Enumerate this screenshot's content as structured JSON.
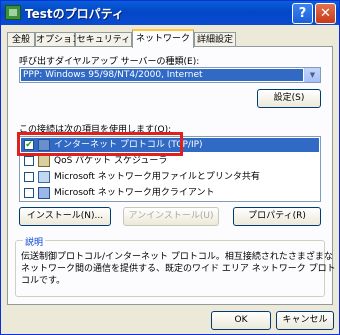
{
  "window": {
    "title": "Testのプロパティ",
    "help_label": "?",
    "close_label": "✕"
  },
  "tabs": [
    {
      "label": "全般",
      "active": false
    },
    {
      "label": "オプション",
      "active": false
    },
    {
      "label": "セキュリティ",
      "active": false
    },
    {
      "label": "ネットワーク",
      "active": true
    },
    {
      "label": "詳細設定",
      "active": false
    }
  ],
  "server_type": {
    "label": "呼び出すダイヤルアップ サーバーの種類(E):",
    "value": "PPP: Windows 95/98/NT4/2000, Internet",
    "settings_button": "設定(S)"
  },
  "components": {
    "label": "この接続は次の項目を使用します(O):",
    "items": [
      {
        "label": "インターネット プロトコル (TCP/IP)",
        "checked": true,
        "icon": "network-protocol-icon",
        "selected": true
      },
      {
        "label": "QoS パケット スケジューラ",
        "checked": false,
        "icon": "scheduler-icon",
        "selected": false
      },
      {
        "label": "Microsoft ネットワーク用ファイルとプリンタ共有",
        "checked": false,
        "icon": "file-printer-sharing-icon",
        "selected": false
      },
      {
        "label": "Microsoft ネットワーク用クライアント",
        "checked": false,
        "icon": "network-client-icon",
        "selected": false
      }
    ],
    "install_button": "インストール(N)...",
    "uninstall_button": "アンインストール(U)",
    "properties_button": "プロパティ(R)"
  },
  "description": {
    "title": "説明",
    "lines": [
      "伝送制御プロトコル/インターネット プロトコル。相互接続されたさまざまな",
      "ネットワーク間の通信を提供する、既定のワイド エリア ネットワーク プロト",
      "コルです。"
    ]
  },
  "footer": {
    "ok_button": "OK",
    "cancel_button": "キャンセル"
  },
  "colors": {
    "highlight_box": "#e0201c",
    "selection": "#316ac5",
    "titlebar": "#0247c7"
  }
}
